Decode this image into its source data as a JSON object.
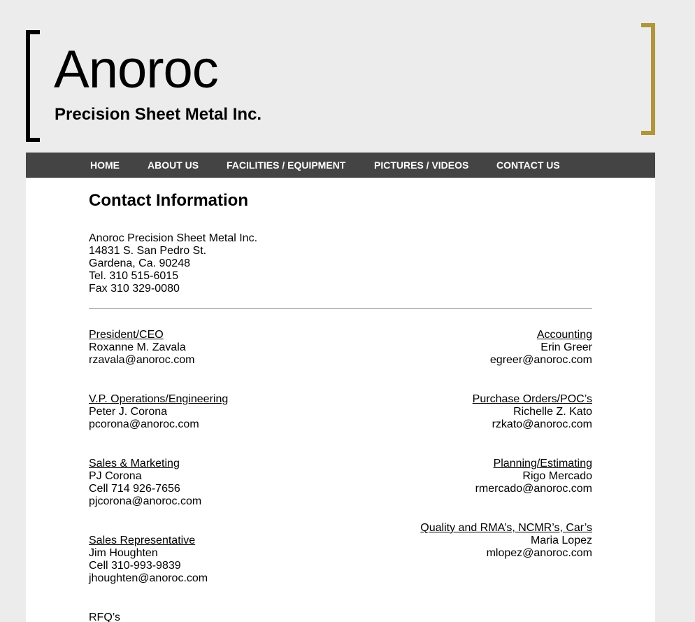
{
  "header": {
    "brand_name": "Anoroc",
    "brand_subtitle": "Precision Sheet Metal Inc.",
    "accent_color": "#b0953a"
  },
  "nav": {
    "items": [
      {
        "label": "HOME"
      },
      {
        "label": "ABOUT US"
      },
      {
        "label": "FACILITIES / EQUIPMENT"
      },
      {
        "label": "PICTURES / VIDEOS"
      },
      {
        "label": "CONTACT US"
      }
    ]
  },
  "main": {
    "title": "Contact Information",
    "address": {
      "company": "Anoroc Precision Sheet Metal Inc.",
      "street": "14831 S. San Pedro St.",
      "city": "Gardena, Ca. 90248",
      "tel": "Tel. 310 515-6015",
      "fax": "Fax 310 329-0080"
    },
    "contacts_left": [
      {
        "role": "President/CEO",
        "name": "Roxanne M. Zavala",
        "email": "rzavala@anoroc.com"
      },
      {
        "role": "V.P. Operations/Engineering",
        "name": "Peter J. Corona",
        "email": "pcorona@anoroc.com"
      },
      {
        "role": "Sales & Marketing",
        "name": "PJ Corona",
        "phone": "Cell 714 926-7656",
        "email": "pjcorona@anoroc.com"
      },
      {
        "role": "Sales Representative",
        "name": "Jim Houghten",
        "phone": "Cell 310-993-9839",
        "email": "jhoughten@anoroc.com"
      },
      {
        "role": "RFQ’s"
      }
    ],
    "contacts_right": [
      {
        "role": "Accounting",
        "name": "Erin Greer",
        "email": "egreer@anoroc.com"
      },
      {
        "role": "Purchase Orders/POC’s",
        "name": "Richelle Z. Kato",
        "email": "rzkato@anoroc.com"
      },
      {
        "role": "Planning/Estimating",
        "name": "Rigo Mercado",
        "email": "rmercado@anoroc.com"
      },
      {
        "role": "Quality and RMA’s, NCMR’s, Car’s",
        "name": "Maria Lopez",
        "email": "mlopez@anoroc.com"
      }
    ]
  }
}
